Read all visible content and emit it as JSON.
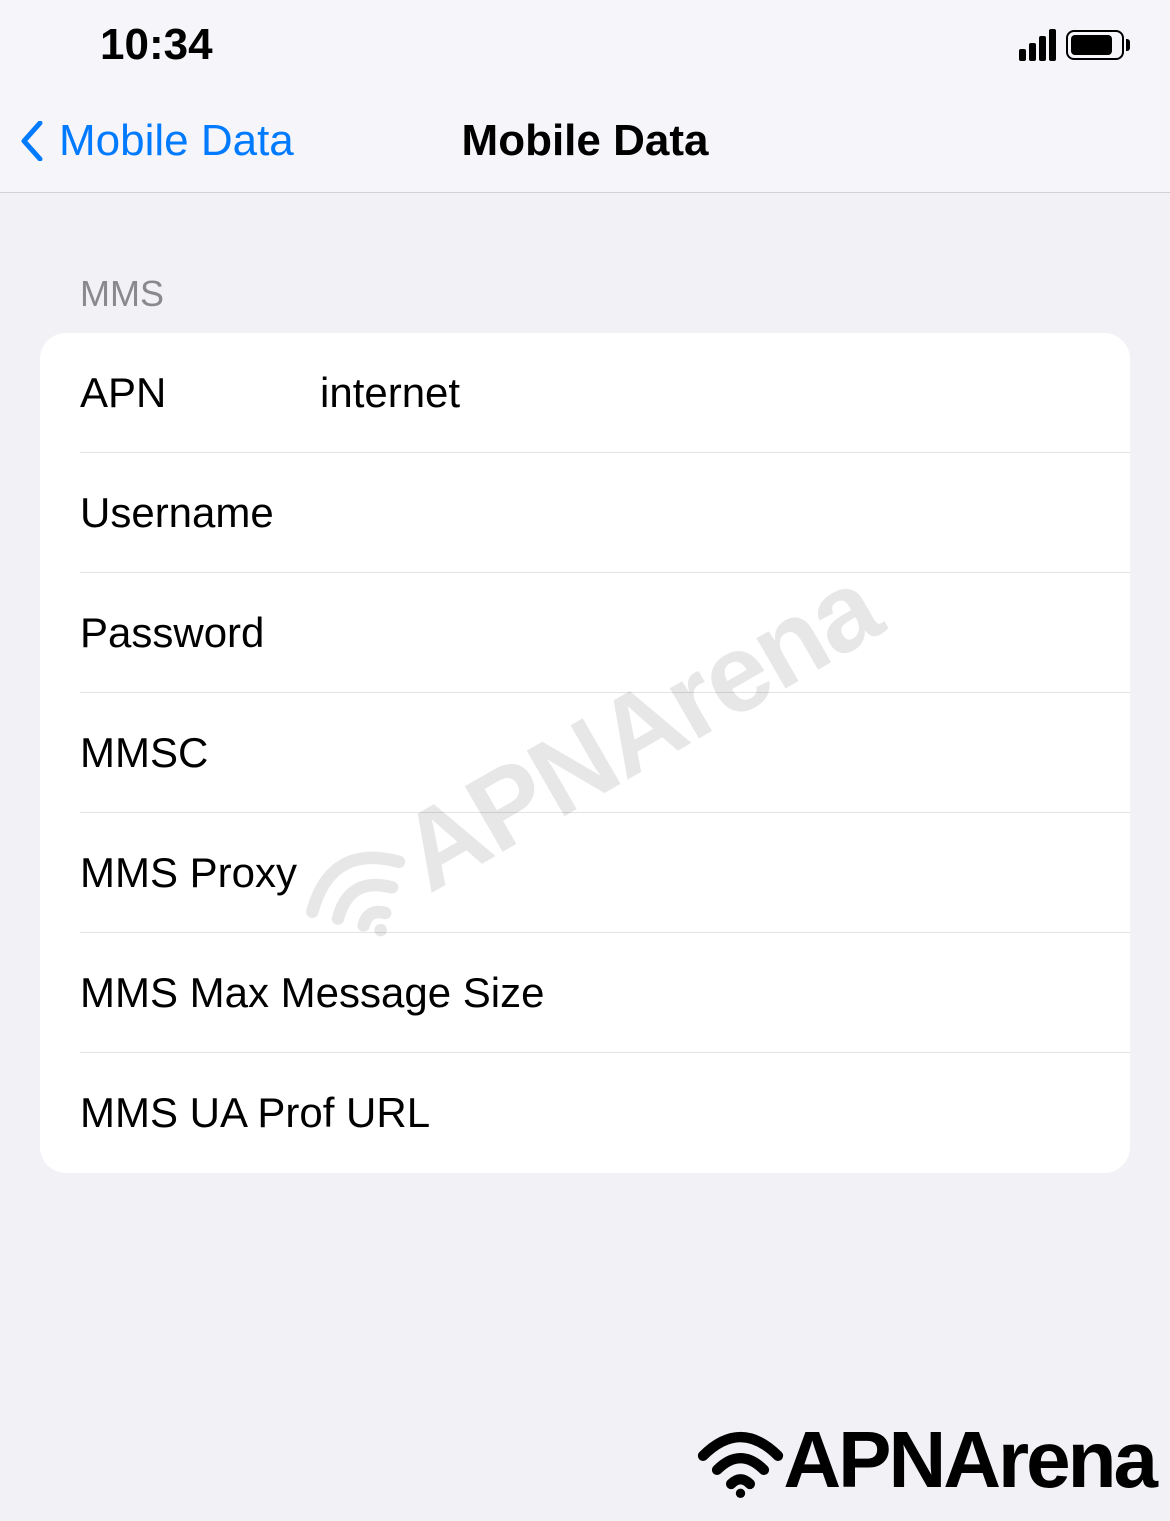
{
  "status": {
    "time": "10:34"
  },
  "nav": {
    "back_label": "Mobile Data",
    "title": "Mobile Data"
  },
  "section": {
    "header": "MMS",
    "fields": {
      "apn_label": "APN",
      "apn_value": "internet",
      "username_label": "Username",
      "username_value": "",
      "password_label": "Password",
      "password_value": "",
      "mmsc_label": "MMSC",
      "mmsc_value": "",
      "mms_proxy_label": "MMS Proxy",
      "mms_proxy_value": "",
      "mms_max_label": "MMS Max Message Size",
      "mms_max_value": "",
      "mms_ua_label": "MMS UA Prof URL",
      "mms_ua_value": ""
    }
  },
  "watermark": "APNArena",
  "brand": "APNArena"
}
